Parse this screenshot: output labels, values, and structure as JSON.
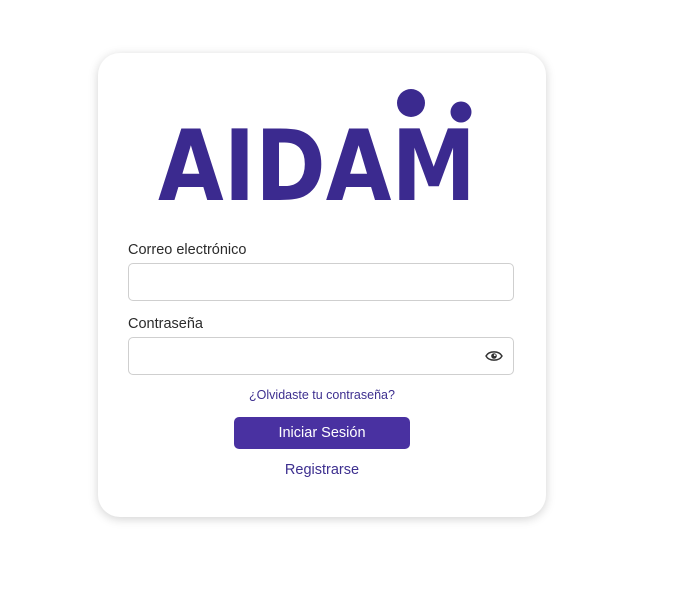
{
  "brand": {
    "logo_text": "AIDAM",
    "color": "#3b2a8f"
  },
  "form": {
    "email_label": "Correo electrónico",
    "email_value": "",
    "password_label": "Contraseña",
    "password_value": "",
    "password_toggle_icon": "eye-icon",
    "forgot_link": "¿Olvidaste tu contraseña?",
    "submit_label": "Iniciar Sesión",
    "register_link": "Registrarse"
  },
  "colors": {
    "primary": "#4931a1",
    "link": "#3d2f8f",
    "border": "#cfcfcf"
  }
}
